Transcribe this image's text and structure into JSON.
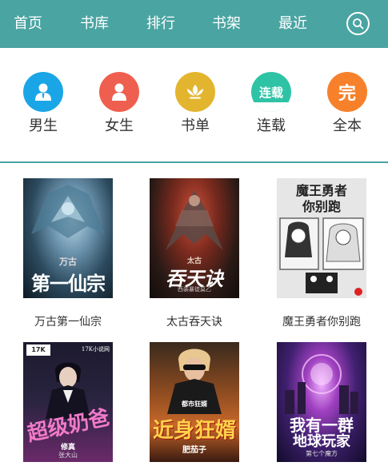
{
  "nav": {
    "items": [
      "首页",
      "书库",
      "排行",
      "书架",
      "最近"
    ],
    "search_icon": "search-icon"
  },
  "categories": [
    {
      "label": "男生",
      "icon": "male-user-icon",
      "color": "#1aa6e6"
    },
    {
      "label": "女生",
      "icon": "female-user-icon",
      "color": "#ef5f4f"
    },
    {
      "label": "书单",
      "icon": "lotus-icon",
      "color": "#e3b52f"
    },
    {
      "label": "连载",
      "icon": "serial-badge-icon",
      "color": "#2fc3a6",
      "glyph": "连载"
    },
    {
      "label": "全本",
      "icon": "complete-badge-icon",
      "color": "#f7812b",
      "glyph": "完"
    }
  ],
  "books": [
    {
      "title": "万古第一仙宗",
      "cover_text": "第一仙宗",
      "cover_sub": "万古"
    },
    {
      "title": "太古吞天诀",
      "cover_text": "吞天诀",
      "cover_sub": "太古",
      "cover_author": "西装暴徒莫乙"
    },
    {
      "title": "魔王勇者你别跑",
      "cover_text": "魔王勇者",
      "cover_text2": "你别跑"
    },
    {
      "title": "",
      "cover_text": "超级奶爸",
      "cover_sub": "修真",
      "cover_brand": "17K小说网",
      "cover_author": "张大山"
    },
    {
      "title": "",
      "cover_text": "近身狂婿",
      "cover_sub": "都市狂婿",
      "cover_author": "肥茄子"
    },
    {
      "title": "",
      "cover_text": "我有一群",
      "cover_text2": "地球玩家",
      "cover_author": "第七个魔方"
    }
  ],
  "colors": {
    "brand": "#4aa4a2"
  }
}
